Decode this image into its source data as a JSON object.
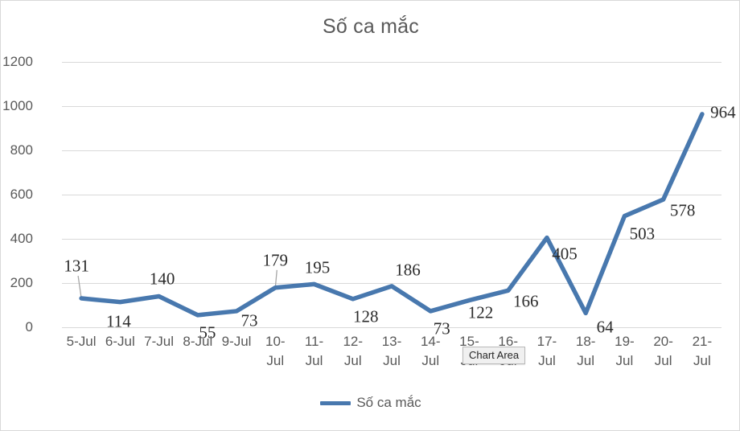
{
  "chart_data": {
    "type": "line",
    "title": "Số ca mắc",
    "xlabel": "",
    "ylabel": "",
    "ylim": [
      0,
      1200
    ],
    "ytick_step": 200,
    "yticks": [
      "0",
      "200",
      "400",
      "600",
      "800",
      "1000",
      "1200"
    ],
    "grid": true,
    "legend_position": "bottom",
    "series_color": "#4878AE",
    "categories": [
      "5-Jul",
      "6-Jul",
      "7-Jul",
      "8-Jul",
      "9-Jul",
      "10-Jul",
      "11-Jul",
      "12-Jul",
      "13-Jul",
      "14-Jul",
      "15-Jul",
      "16-Jul",
      "17-Jul",
      "18-Jul",
      "19-Jul",
      "20-Jul",
      "21-Jul"
    ],
    "series": [
      {
        "name": "Số ca mắc",
        "values": [
          131,
          114,
          140,
          55,
          73,
          179,
          195,
          128,
          186,
          73,
          122,
          166,
          405,
          64,
          503,
          578,
          964
        ]
      }
    ],
    "data_labels": [
      "131",
      "114",
      "140",
      "55",
      "73",
      "179",
      "195",
      "128",
      "186",
      "73",
      "122",
      "166",
      "405",
      "64",
      "503",
      "578",
      "964"
    ]
  },
  "legend": {
    "entry_label": "Số ca mắc"
  },
  "tooltip": {
    "text": "Chart Area"
  }
}
